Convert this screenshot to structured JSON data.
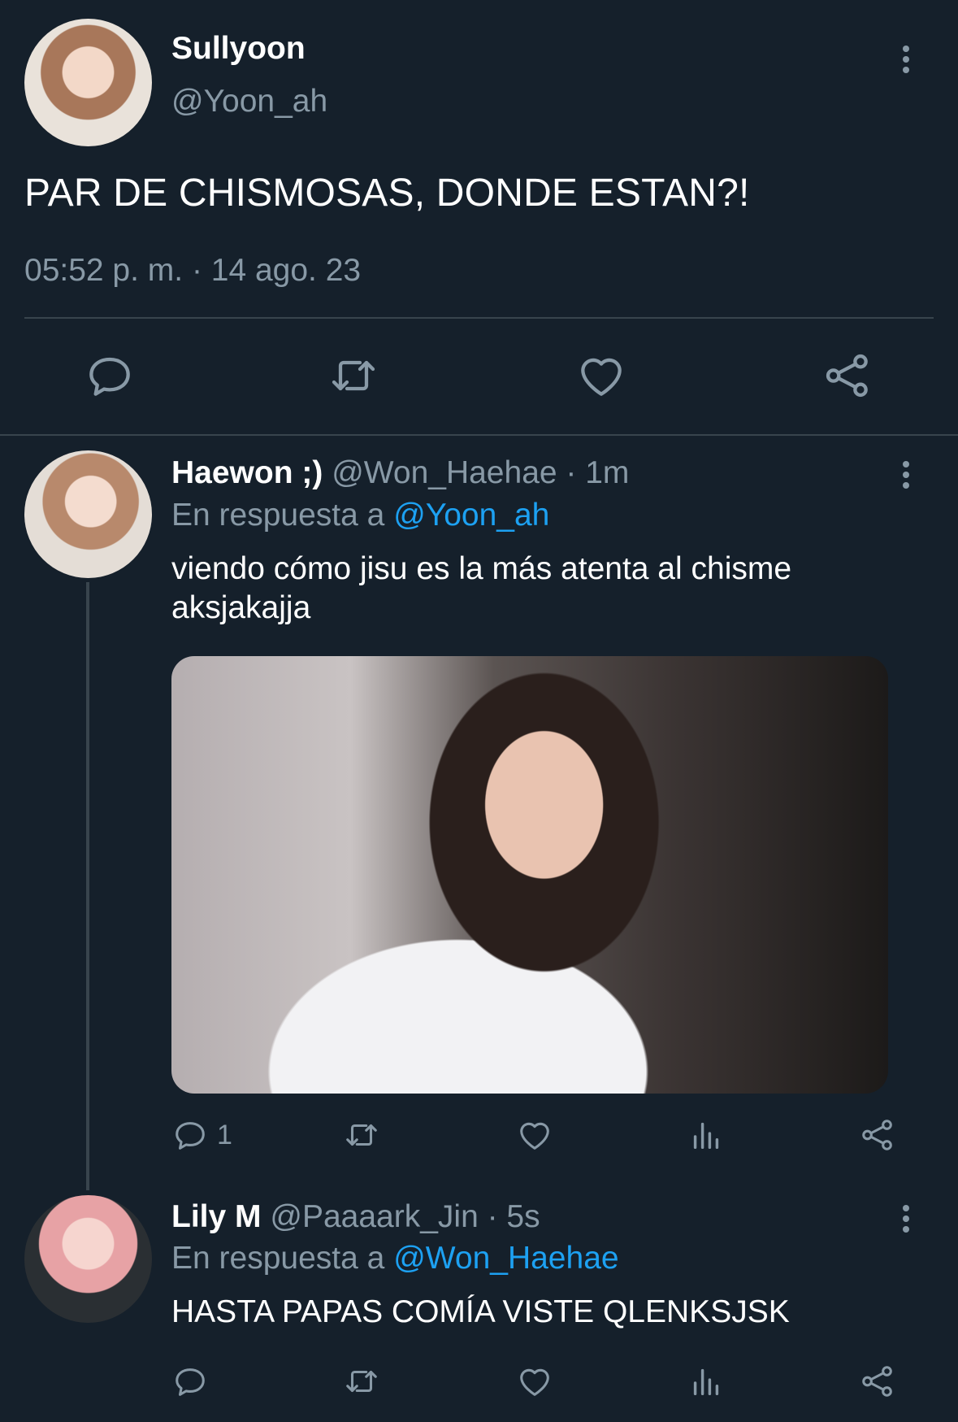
{
  "main_tweet": {
    "name": "Sullyoon",
    "handle": "@Yoon_ah",
    "text": "PAR DE CHISMOSAS, DONDE ESTAN?!",
    "timestamp": "05:52 p. m. · 14 ago. 23",
    "actions": [
      "reply-icon",
      "retweet-icon",
      "like-icon",
      "share-icon"
    ]
  },
  "replies": [
    {
      "name": "Haewon ;)",
      "handle": "@Won_Haehae",
      "time": "· 1m",
      "replying_prefix": "En respuesta a",
      "replying_to": "@Yoon_ah",
      "text_line1": "viendo cómo jisu es la más atenta al chisme",
      "text_line2": "aksjakajja",
      "has_media": true,
      "reply_count": "1"
    },
    {
      "name": "Lily M",
      "handle": "@Paaaark_Jin",
      "time": "· 5s",
      "replying_prefix": "En respuesta a",
      "replying_to": "@Won_Haehae",
      "text_line1": "HASTA PAPAS COMÍA VISTE QLENKSJSK",
      "reply_count": ""
    }
  ],
  "colors": {
    "background": "#15202b",
    "divider": "#38444d",
    "secondary_text": "#8899a6",
    "link": "#1da1f2"
  }
}
